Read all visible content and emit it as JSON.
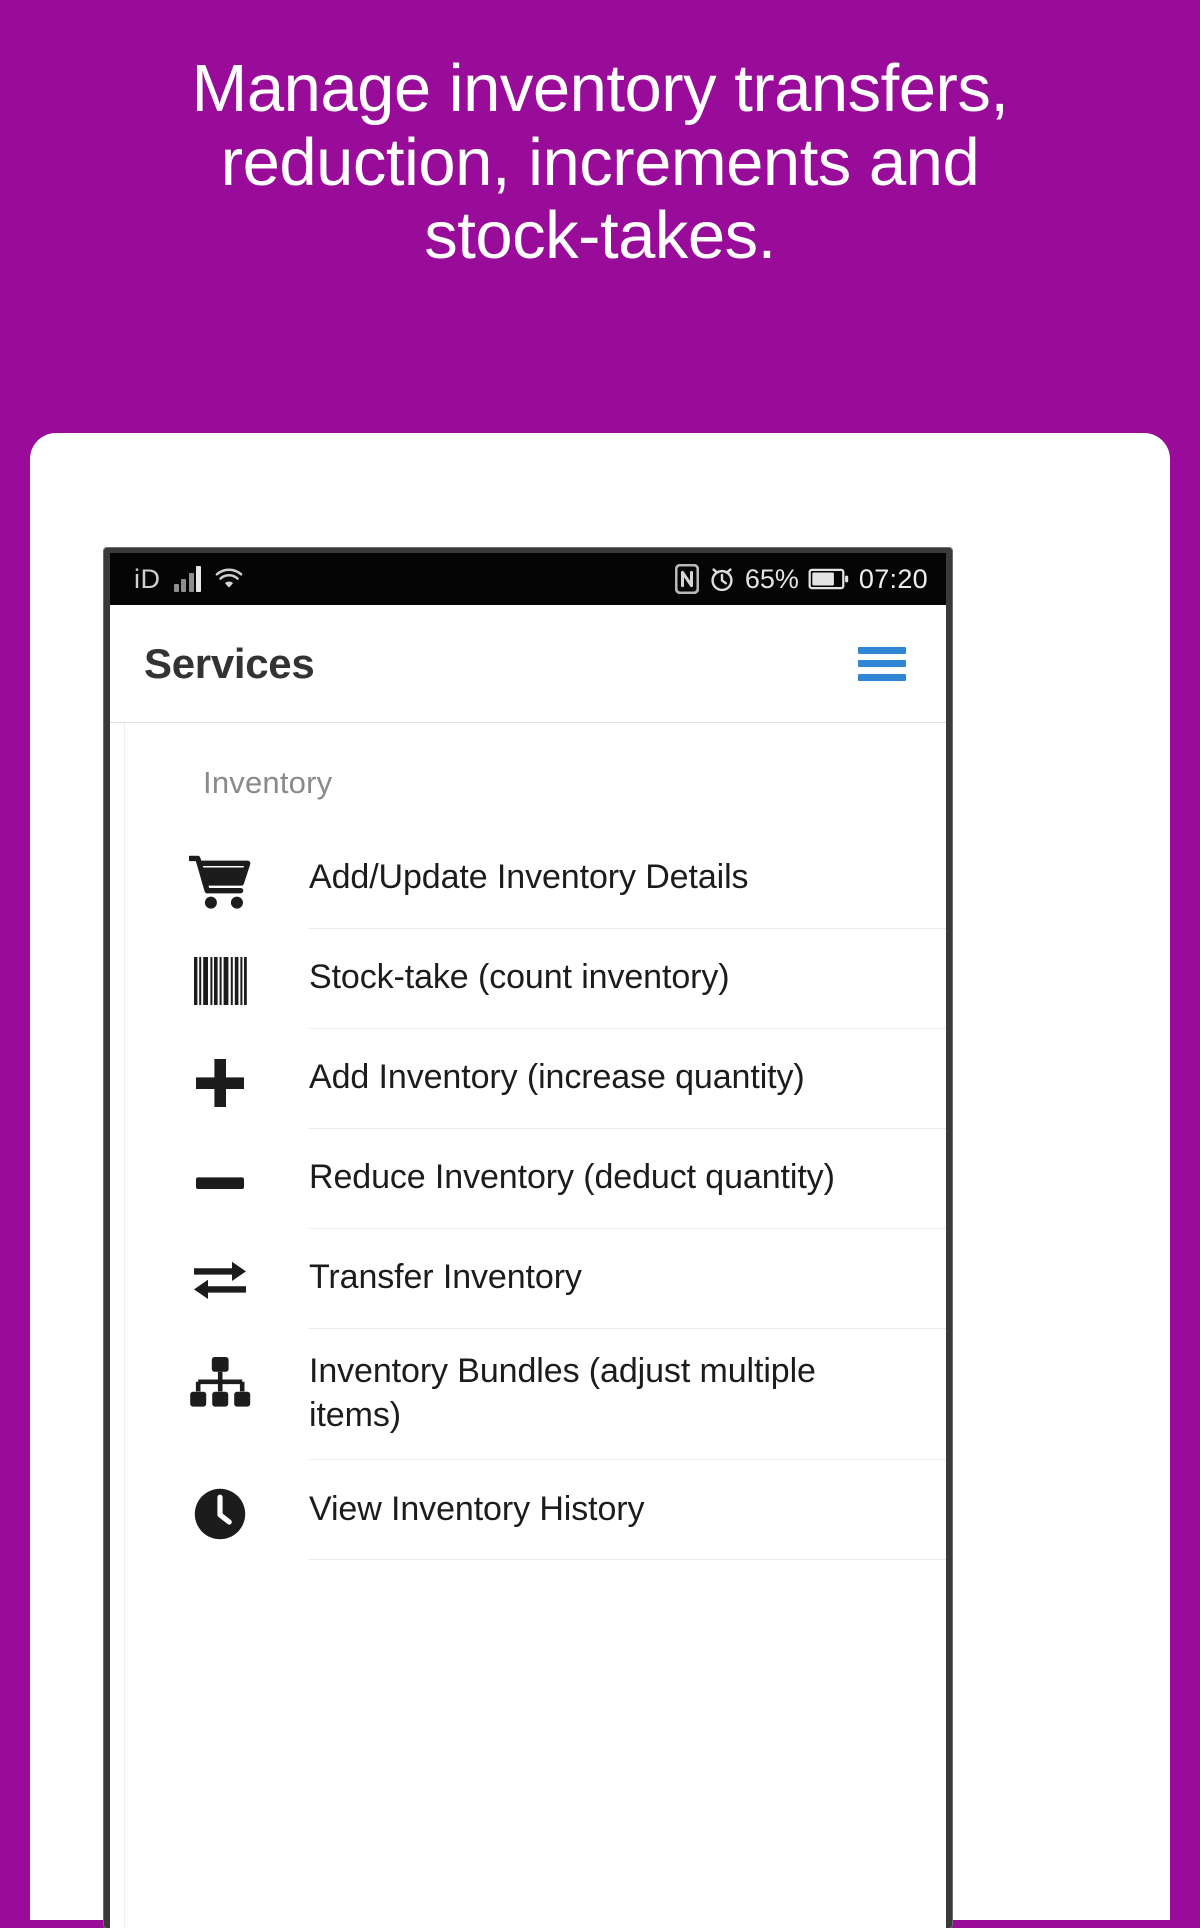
{
  "promo": {
    "background_color": "#990B99",
    "headline_lines": [
      "Manage inventory transfers,",
      "reduction, increments and",
      "stock-takes."
    ]
  },
  "phone": {
    "status_bar": {
      "carrier": "iD",
      "signal_icon": "signal-bars-icon",
      "wifi_icon": "wifi-icon",
      "nfc_icon": "nfc-icon",
      "alarm_icon": "alarm-clock-icon",
      "battery_percent": "65%",
      "battery_icon": "battery-icon",
      "clock": "07:20"
    },
    "app_bar": {
      "title": "Services",
      "menu_icon": "hamburger-menu-icon",
      "menu_color": "#2F86D4"
    },
    "content": {
      "section_title": "Inventory",
      "items": [
        {
          "label": "Add/Update Inventory Details",
          "icon": "shopping-cart-icon"
        },
        {
          "label": "Stock-take (count inventory)",
          "icon": "barcode-icon"
        },
        {
          "label": "Add Inventory (increase quantity)",
          "icon": "plus-icon"
        },
        {
          "label": "Reduce Inventory (deduct quantity)",
          "icon": "minus-icon"
        },
        {
          "label": "Transfer Inventory",
          "icon": "transfer-arrows-icon"
        },
        {
          "label": "Inventory Bundles (adjust multiple items)",
          "icon": "hierarchy-icon"
        },
        {
          "label": "View Inventory History",
          "icon": "clock-icon"
        }
      ]
    }
  }
}
